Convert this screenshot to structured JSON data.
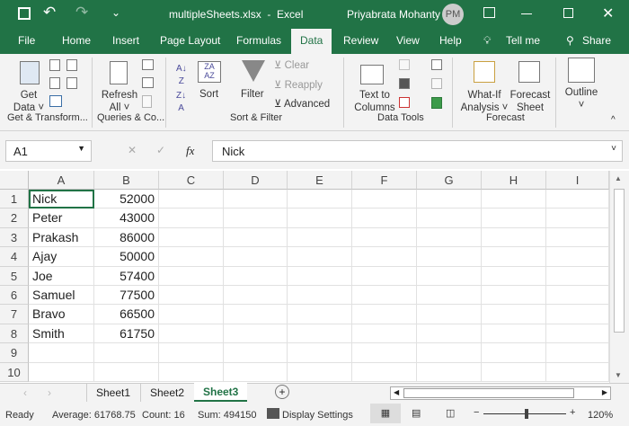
{
  "title": {
    "file": "multipleSheets.xlsx  -  Excel",
    "user": "Priyabrata Mohanty",
    "initials": "PM"
  },
  "tabs": [
    "File",
    "Home",
    "Insert",
    "Page Layout",
    "Formulas",
    "Data",
    "Review",
    "View",
    "Help",
    "Tell me",
    "Share"
  ],
  "ribbon": {
    "get_data": [
      "Get",
      "Data ˅"
    ],
    "refresh": [
      "Refresh",
      "All ˅"
    ],
    "sort": "Sort",
    "filter": "Filter",
    "clear": "Clear",
    "reapply": "Reapply",
    "advanced": "Advanced",
    "text_to_columns": [
      "Text to",
      "Columns"
    ],
    "what_if": [
      "What-If",
      "Analysis ˅"
    ],
    "forecast_sheet": [
      "Forecast",
      "Sheet"
    ],
    "outline": "Outline",
    "groups": [
      "Get & Transform...",
      "Queries & Co...",
      "Sort & Filter",
      "Data Tools",
      "Forecast"
    ]
  },
  "formula_bar": {
    "name_box": "A1",
    "fx": "fx",
    "value": "Nick"
  },
  "columns": [
    "A",
    "B",
    "C",
    "D",
    "E",
    "F",
    "G",
    "H",
    "I"
  ],
  "rows": [
    [
      "Nick",
      "52000"
    ],
    [
      "Peter",
      "43000"
    ],
    [
      "Prakash",
      "86000"
    ],
    [
      "Ajay",
      "50000"
    ],
    [
      "Joe",
      "57400"
    ],
    [
      "Samuel",
      "77500"
    ],
    [
      "Bravo",
      "66500"
    ],
    [
      "Smith",
      "61750"
    ],
    [
      "",
      ""
    ],
    [
      "",
      ""
    ]
  ],
  "sheets": [
    "Sheet1",
    "Sheet2",
    "Sheet3"
  ],
  "active_sheet": "Sheet3",
  "status": {
    "ready": "Ready",
    "average": "Average: 61768.75",
    "count": "Count: 16",
    "sum": "Sum: 494150",
    "display": "Display Settings",
    "zoom": "120%"
  },
  "colors": {
    "accent": "#217346"
  }
}
